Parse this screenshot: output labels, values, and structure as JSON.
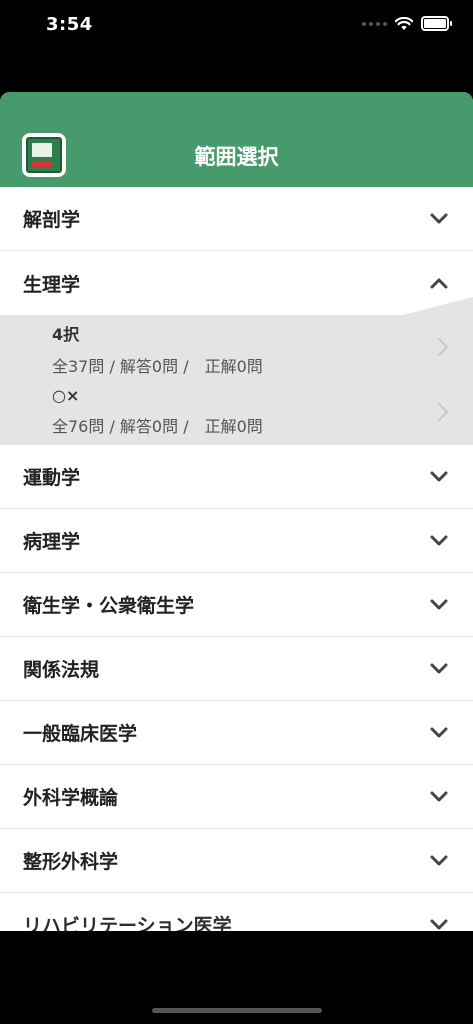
{
  "status_bar": {
    "time": "3:54"
  },
  "header": {
    "title": "範囲選択"
  },
  "categories": [
    {
      "label": "解剖学",
      "expanded": false
    },
    {
      "label": "生理学",
      "expanded": true,
      "sub_items": [
        {
          "title": "4択",
          "stats": "全37問 / 解答0問 /　正解0問"
        },
        {
          "title": "○×",
          "stats": "全76問 / 解答0問 /　正解0問"
        }
      ]
    },
    {
      "label": "運動学",
      "expanded": false
    },
    {
      "label": "病理学",
      "expanded": false
    },
    {
      "label": "衛生学・公衆衛生学",
      "expanded": false
    },
    {
      "label": "関係法規",
      "expanded": false
    },
    {
      "label": "一般臨床医学",
      "expanded": false
    },
    {
      "label": "外科学概論",
      "expanded": false
    },
    {
      "label": "整形外科学",
      "expanded": false
    },
    {
      "label": "リハビリテーション医学",
      "expanded": false
    }
  ],
  "colors": {
    "header_bg": "#479a6c",
    "expanded_bg": "#e4e4e4"
  },
  "icons": {
    "collapsed": "chevron-down-icon",
    "expanded": "chevron-up-icon",
    "sub": "chevron-right-icon"
  }
}
